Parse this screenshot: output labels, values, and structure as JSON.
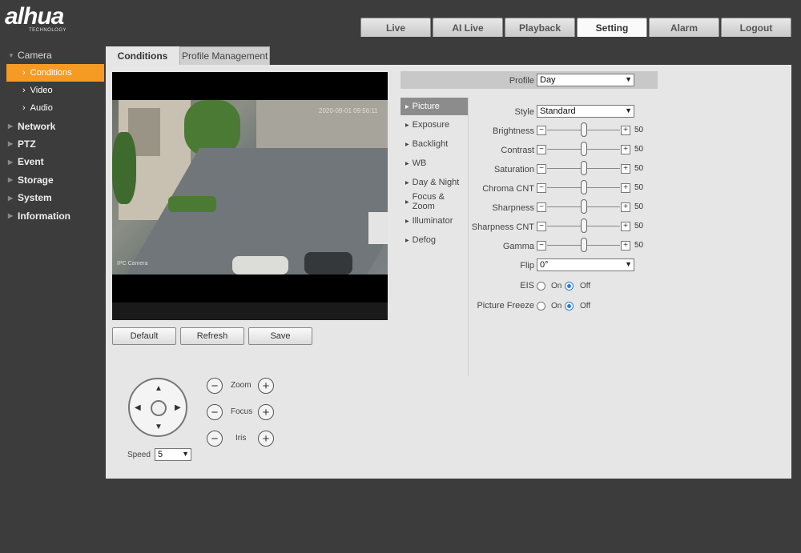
{
  "brand": {
    "logo": "alhua",
    "logo_sub": "TECHNOLOGY"
  },
  "top_nav": [
    "Live",
    "AI Live",
    "Playback",
    "Setting",
    "Alarm",
    "Logout"
  ],
  "top_nav_active": "Setting",
  "sidebar": {
    "camera": "Camera",
    "camera_items": [
      "Conditions",
      "Video",
      "Audio"
    ],
    "groups": [
      "Network",
      "PTZ",
      "Event",
      "Storage",
      "System",
      "Information"
    ]
  },
  "content_tabs": [
    "Conditions",
    "Profile Management"
  ],
  "video": {
    "osd_time": "2020-09-01 09:56:11",
    "osd_name": "IPC Camera"
  },
  "buttons": {
    "default": "Default",
    "refresh": "Refresh",
    "save": "Save"
  },
  "ptz": {
    "zoom": "Zoom",
    "focus": "Focus",
    "iris": "Iris",
    "speed_label": "Speed",
    "speed_value": "5"
  },
  "profile": {
    "label": "Profile",
    "value": "Day"
  },
  "param_tabs": [
    "Picture",
    "Exposure",
    "Backlight",
    "WB",
    "Day & Night",
    "Focus & Zoom",
    "Illuminator",
    "Defog"
  ],
  "picture": {
    "style_label": "Style",
    "style_value": "Standard",
    "sliders": [
      {
        "label": "Brightness",
        "value": "50"
      },
      {
        "label": "Contrast",
        "value": "50"
      },
      {
        "label": "Saturation",
        "value": "50"
      },
      {
        "label": "Chroma CNT",
        "value": "50"
      },
      {
        "label": "Sharpness",
        "value": "50"
      },
      {
        "label": "Sharpness CNT",
        "value": "50"
      },
      {
        "label": "Gamma",
        "value": "50"
      }
    ],
    "flip_label": "Flip",
    "flip_value": "0°",
    "eis_label": "EIS",
    "freeze_label": "Picture Freeze",
    "on": "On",
    "off": "Off"
  },
  "colors": {
    "accent": "#f59a23",
    "tab_active": "#8c8c8c",
    "radio": "#2a7ad6"
  }
}
